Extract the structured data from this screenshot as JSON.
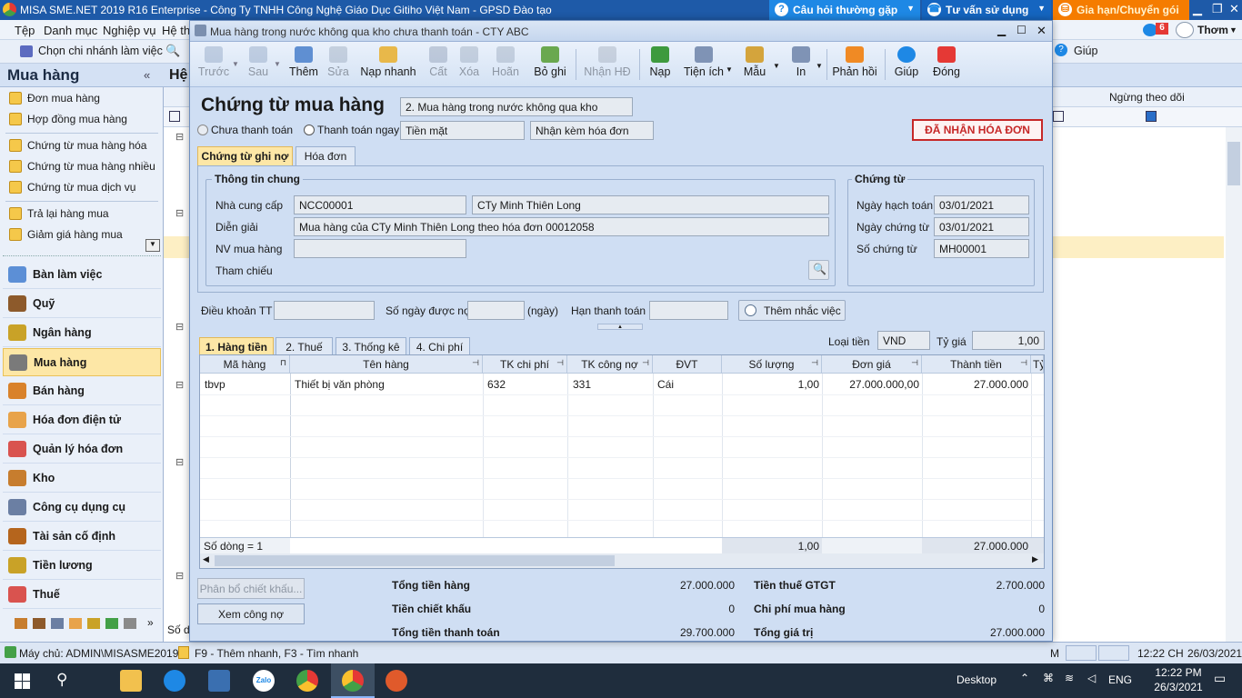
{
  "app": {
    "title": "MISA SME.NET 2019 R16 Enterprise - Công Ty TNHH Công Nghệ Giáo Dục Gitiho Việt Nam - GPSD Đào tạo",
    "top_buttons": {
      "faq": "Câu hỏi thường gặp",
      "advice": "Tư vấn sử dụng",
      "renew": "Gia hạn/Chuyển gói"
    },
    "user": "Thơm",
    "notif_count": "6"
  },
  "menu": {
    "items": [
      "Tệp",
      "Danh mục",
      "Nghiệp vụ",
      "Hệ th"
    ],
    "branch": "Chọn chi nhánh làm việc",
    "help": "Giúp"
  },
  "sidebar": {
    "title": "Mua hàng",
    "sub_items": [
      "Đơn mua hàng",
      "Hợp đồng mua hàng",
      "Chứng từ mua hàng hóa",
      "Chứng từ mua hàng nhiều...",
      "Chứng từ mua dịch vụ",
      "Trả lại hàng mua",
      "Giảm giá hàng mua"
    ],
    "modules": [
      "Bàn làm việc",
      "Quỹ",
      "Ngân hàng",
      "Mua hàng",
      "Bán hàng",
      "Hóa đơn điện tử",
      "Quản lý hóa đơn",
      "Kho",
      "Công cụ dụng cụ",
      "Tài sản cố định",
      "Tiền lương",
      "Thuế"
    ],
    "active_module": "Mua hàng",
    "colors": {
      "active": "#fde7a6"
    }
  },
  "background": {
    "header_label": "Hệ",
    "column_header": "Ngừng theo dõi",
    "footer": "Số dò"
  },
  "dialog": {
    "title": "Mua hàng trong nước không qua kho chưa thanh toán - CTY ABC",
    "toolbar": [
      "Trước",
      "Sau",
      "Thêm",
      "Sửa",
      "Nạp nhanh",
      "Cất",
      "Xóa",
      "Hoãn",
      "Bỏ ghi",
      "Nhận HĐ",
      "Nạp",
      "Tiện ích",
      "Mẫu",
      "In",
      "Phản hồi",
      "Giúp",
      "Đóng"
    ],
    "heading": "Chứng từ mua hàng",
    "type": "2. Mua hàng trong nước không qua kho",
    "radio_unpaid": "Chưa thanh toán",
    "radio_paid": "Thanh toán ngay",
    "payment_method": "Tiền mặt",
    "invoice_option": "Nhận kèm hóa đơn",
    "status_badge": "ĐÃ NHẬN HÓA ĐƠN",
    "tabs": [
      "Chứng từ ghi nợ",
      "Hóa đơn"
    ],
    "general": {
      "title": "Thông tin chung",
      "supplier_label": "Nhà cung cấp",
      "supplier_code": "NCC00001",
      "supplier_name": "CTy Minh Thiên Long",
      "desc_label": "Diễn giải",
      "desc": "Mua hàng của CTy Minh Thiên Long theo hóa đơn 00012058",
      "staff_label": "NV mua hàng",
      "staff": "",
      "ref_label": "Tham chiếu"
    },
    "voucher": {
      "title": "Chứng từ",
      "post_date_label": "Ngày hạch toán",
      "post_date": "03/01/2021",
      "doc_date_label": "Ngày chứng từ",
      "doc_date": "03/01/2021",
      "doc_no_label": "Số chứng từ",
      "doc_no": "MH00001"
    },
    "terms": {
      "terms_label": "Điều khoản TT",
      "days_label": "Số ngày được nợ",
      "days_unit": "(ngày)",
      "due_label": "Hạn thanh toán",
      "reminder": "Thêm nhắc việc"
    },
    "detail_tabs": [
      "1. Hàng tiền",
      "2. Thuế",
      "3. Thống kê",
      "4. Chi phí"
    ],
    "currency_label": "Loại tiền",
    "currency": "VND",
    "rate_label": "Tỷ giá",
    "rate": "1,00",
    "grid": {
      "headers": [
        "Mã hàng",
        "Tên hàng",
        "TK chi phí",
        "TK công nợ",
        "ĐVT",
        "Số lượng",
        "Đơn giá",
        "Thành tiền",
        "Tỷ"
      ],
      "rows": [
        [
          "tbvp",
          "Thiết bị văn phòng",
          "632",
          "331",
          "Cái",
          "1,00",
          "27.000.000,00",
          "27.000.000"
        ]
      ],
      "footer_count": "Số dòng = 1",
      "footer_qty": "1,00",
      "footer_amount": "27.000.000"
    },
    "buttons": {
      "discount": "Phân bổ chiết khấu...",
      "debt": "Xem công nợ"
    },
    "totals": {
      "goods_label": "Tổng tiền hàng",
      "goods": "27.000.000",
      "discount_label": "Tiền chiết khấu",
      "discount": "0",
      "payment_label": "Tổng tiền thanh toán",
      "payment": "29.700.000",
      "vat_label": "Tiền thuế GTGT",
      "vat": "2.700.000",
      "cost_label": "Chi phí mua hàng",
      "cost": "0",
      "value_label": "Tổng giá trị",
      "value": "27.000.000"
    }
  },
  "statusbar": {
    "server": "Máy chủ: ADMIN\\MISASME2019",
    "hint": "F9 - Thêm nhanh, F3 - Tìm nhanh",
    "mode": "M",
    "time": "12:22 CH",
    "date": "26/03/2021"
  },
  "taskbar": {
    "desktop": "Desktop",
    "lang": "ENG",
    "time": "12:22 PM",
    "date": "26/3/2021",
    "zalo": "Zalo"
  }
}
